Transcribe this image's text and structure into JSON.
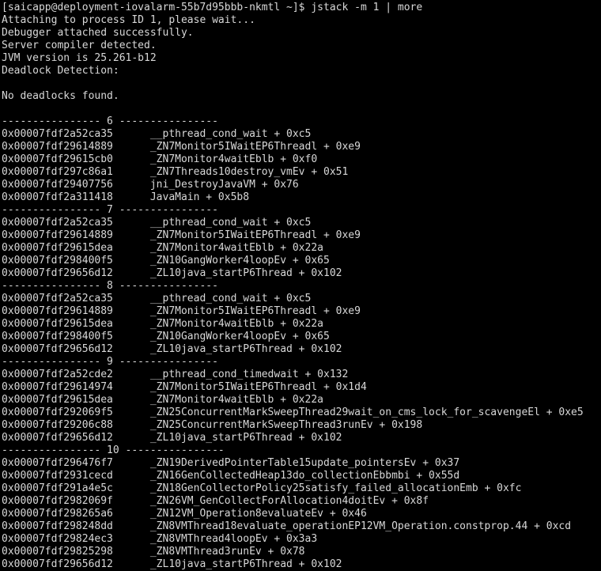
{
  "terminal": {
    "window_title": "jstack terminal output",
    "background_color": "#000000",
    "foreground_color": "#d8d8d8",
    "columns": 94,
    "rows": 45,
    "prompt": {
      "user": "saicapp",
      "host": "deployment-iovalarm-55b7d95bbb-nkmtl",
      "cwd": "~",
      "symbol": "$",
      "full": "[saicapp@deployment-iovalarm-55b7d95bbb-nkmtl ~]$",
      "command": "jstack -m 1 | more"
    },
    "lines": [
      "[saicapp@deployment-iovalarm-55b7d95bbb-nkmtl ~]$ jstack -m 1 | more",
      "Attaching to process ID 1, please wait...",
      "Debugger attached successfully.",
      "Server compiler detected.",
      "JVM version is 25.261-b12",
      "Deadlock Detection:",
      "",
      "No deadlocks found.",
      "",
      "---------------- 6 ----------------",
      "0x00007fdf2a52ca35\t__pthread_cond_wait + 0xc5",
      "0x00007fdf29614889\t_ZN7Monitor5IWaitEP6Threadl + 0xe9",
      "0x00007fdf29615cb0\t_ZN7Monitor4waitEblb + 0xf0",
      "0x00007fdf297c86a1\t_ZN7Threads10destroy_vmEv + 0x51",
      "0x00007fdf29407756\tjni_DestroyJavaVM + 0x76",
      "0x00007fdf2a311418\tJavaMain + 0x5b8",
      "---------------- 7 ----------------",
      "0x00007fdf2a52ca35\t__pthread_cond_wait + 0xc5",
      "0x00007fdf29614889\t_ZN7Monitor5IWaitEP6Threadl + 0xe9",
      "0x00007fdf29615dea\t_ZN7Monitor4waitEblb + 0x22a",
      "0x00007fdf298400f5\t_ZN10GangWorker4loopEv + 0x65",
      "0x00007fdf29656d12\t_ZL10java_startP6Thread + 0x102",
      "---------------- 8 ----------------",
      "0x00007fdf2a52ca35\t__pthread_cond_wait + 0xc5",
      "0x00007fdf29614889\t_ZN7Monitor5IWaitEP6Threadl + 0xe9",
      "0x00007fdf29615dea\t_ZN7Monitor4waitEblb + 0x22a",
      "0x00007fdf298400f5\t_ZN10GangWorker4loopEv + 0x65",
      "0x00007fdf29656d12\t_ZL10java_startP6Thread + 0x102",
      "---------------- 9 ----------------",
      "0x00007fdf2a52cde2\t__pthread_cond_timedwait + 0x132",
      "0x00007fdf29614974\t_ZN7Monitor5IWaitEP6Threadl + 0x1d4",
      "0x00007fdf29615dea\t_ZN7Monitor4waitEblb + 0x22a",
      "0x00007fdf292069f5\t_ZN25ConcurrentMarkSweepThread29wait_on_cms_lock_for_scavengeEl + 0xe5",
      "0x00007fdf29206c88\t_ZN25ConcurrentMarkSweepThread3runEv + 0x198",
      "0x00007fdf29656d12\t_ZL10java_startP6Thread + 0x102",
      "---------------- 10 ----------------",
      "0x00007fdf296476f7\t_ZN19DerivedPointerTable15update_pointersEv + 0x37",
      "0x00007fdf2931cecd\t_ZN16GenCollectedHeap13do_collectionEbbmbi + 0x55d",
      "0x00007fdf291a4e5c\t_ZN18GenCollectorPolicy25satisfy_failed_allocationEmb + 0xfc",
      "0x00007fdf2982069f\t_ZN26VM_GenCollectForAllocation4doitEv + 0x8f",
      "0x00007fdf298265a6\t_ZN12VM_Operation8evaluateEv + 0x46",
      "0x00007fdf298248dd\t_ZN8VMThread18evaluate_operationEP12VM_Operation.constprop.44 + 0xcd",
      "0x00007fdf29824ec3\t_ZN8VMThread4loopEv + 0x3a3",
      "0x00007fdf29825298\t_ZN8VMThread3runEv + 0x78",
      "0x00007fdf29656d12\t_ZL10java_startP6Thread + 0x102"
    ],
    "threads": [
      {
        "id": "6",
        "separator": "---------------- 6 ----------------",
        "frames": [
          {
            "address": "0x00007fdf2a52ca35",
            "symbol": "__pthread_cond_wait",
            "offset": "0xc5"
          },
          {
            "address": "0x00007fdf29614889",
            "symbol": "_ZN7Monitor5IWaitEP6Threadl",
            "offset": "0xe9"
          },
          {
            "address": "0x00007fdf29615cb0",
            "symbol": "_ZN7Monitor4waitEblb",
            "offset": "0xf0"
          },
          {
            "address": "0x00007fdf297c86a1",
            "symbol": "_ZN7Threads10destroy_vmEv",
            "offset": "0x51"
          },
          {
            "address": "0x00007fdf29407756",
            "symbol": "jni_DestroyJavaVM",
            "offset": "0x76"
          },
          {
            "address": "0x00007fdf2a311418",
            "symbol": "JavaMain",
            "offset": "0x5b8"
          }
        ]
      },
      {
        "id": "7",
        "separator": "---------------- 7 ----------------",
        "frames": [
          {
            "address": "0x00007fdf2a52ca35",
            "symbol": "__pthread_cond_wait",
            "offset": "0xc5"
          },
          {
            "address": "0x00007fdf29614889",
            "symbol": "_ZN7Monitor5IWaitEP6Threadl",
            "offset": "0xe9"
          },
          {
            "address": "0x00007fdf29615dea",
            "symbol": "_ZN7Monitor4waitEblb",
            "offset": "0x22a"
          },
          {
            "address": "0x00007fdf298400f5",
            "symbol": "_ZN10GangWorker4loopEv",
            "offset": "0x65"
          },
          {
            "address": "0x00007fdf29656d12",
            "symbol": "_ZL10java_startP6Thread",
            "offset": "0x102"
          }
        ]
      },
      {
        "id": "8",
        "separator": "---------------- 8 ----------------",
        "frames": [
          {
            "address": "0x00007fdf2a52ca35",
            "symbol": "__pthread_cond_wait",
            "offset": "0xc5"
          },
          {
            "address": "0x00007fdf29614889",
            "symbol": "_ZN7Monitor5IWaitEP6Threadl",
            "offset": "0xe9"
          },
          {
            "address": "0x00007fdf29615dea",
            "symbol": "_ZN7Monitor4waitEblb",
            "offset": "0x22a"
          },
          {
            "address": "0x00007fdf298400f5",
            "symbol": "_ZN10GangWorker4loopEv",
            "offset": "0x65"
          },
          {
            "address": "0x00007fdf29656d12",
            "symbol": "_ZL10java_startP6Thread",
            "offset": "0x102"
          }
        ]
      },
      {
        "id": "9",
        "separator": "---------------- 9 ----------------",
        "frames": [
          {
            "address": "0x00007fdf2a52cde2",
            "symbol": "__pthread_cond_timedwait",
            "offset": "0x132"
          },
          {
            "address": "0x00007fdf29614974",
            "symbol": "_ZN7Monitor5IWaitEP6Threadl",
            "offset": "0x1d4"
          },
          {
            "address": "0x00007fdf29615dea",
            "symbol": "_ZN7Monitor4waitEblb",
            "offset": "0x22a"
          },
          {
            "address": "0x00007fdf292069f5",
            "symbol": "_ZN25ConcurrentMarkSweepThread29wait_on_cms_lock_for_scavengeEl",
            "offset": "0xe5"
          },
          {
            "address": "0x00007fdf29206c88",
            "symbol": "_ZN25ConcurrentMarkSweepThread3runEv",
            "offset": "0x198"
          },
          {
            "address": "0x00007fdf29656d12",
            "symbol": "_ZL10java_startP6Thread",
            "offset": "0x102"
          }
        ]
      },
      {
        "id": "10",
        "separator": "---------------- 10 ----------------",
        "frames": [
          {
            "address": "0x00007fdf296476f7",
            "symbol": "_ZN19DerivedPointerTable15update_pointersEv",
            "offset": "0x37"
          },
          {
            "address": "0x00007fdf2931cecd",
            "symbol": "_ZN16GenCollectedHeap13do_collectionEbbmbi",
            "offset": "0x55d"
          },
          {
            "address": "0x00007fdf291a4e5c",
            "symbol": "_ZN18GenCollectorPolicy25satisfy_failed_allocationEmb",
            "offset": "0xfc"
          },
          {
            "address": "0x00007fdf2982069f",
            "symbol": "_ZN26VM_GenCollectForAllocation4doitEv",
            "offset": "0x8f"
          },
          {
            "address": "0x00007fdf298265a6",
            "symbol": "_ZN12VM_Operation8evaluateEv",
            "offset": "0x46"
          },
          {
            "address": "0x00007fdf298248dd",
            "symbol": "_ZN8VMThread18evaluate_operationEP12VM_Operation.constprop.44",
            "offset": "0xcd"
          },
          {
            "address": "0x00007fdf29824ec3",
            "symbol": "_ZN8VMThread4loopEv",
            "offset": "0x3a3"
          },
          {
            "address": "0x00007fdf29825298",
            "symbol": "_ZN8VMThread3runEv",
            "offset": "0x78"
          },
          {
            "address": "0x00007fdf29656d12",
            "symbol": "_ZL10java_startP6Thread",
            "offset": "0x102"
          }
        ]
      }
    ],
    "header_messages": {
      "attaching": "Attaching to process ID 1, please wait...",
      "debugger": "Debugger attached successfully.",
      "compiler": "Server compiler detected.",
      "jvm_version": "JVM version is 25.261-b12",
      "deadlock_heading": "Deadlock Detection:",
      "deadlock_result": "No deadlocks found."
    }
  }
}
